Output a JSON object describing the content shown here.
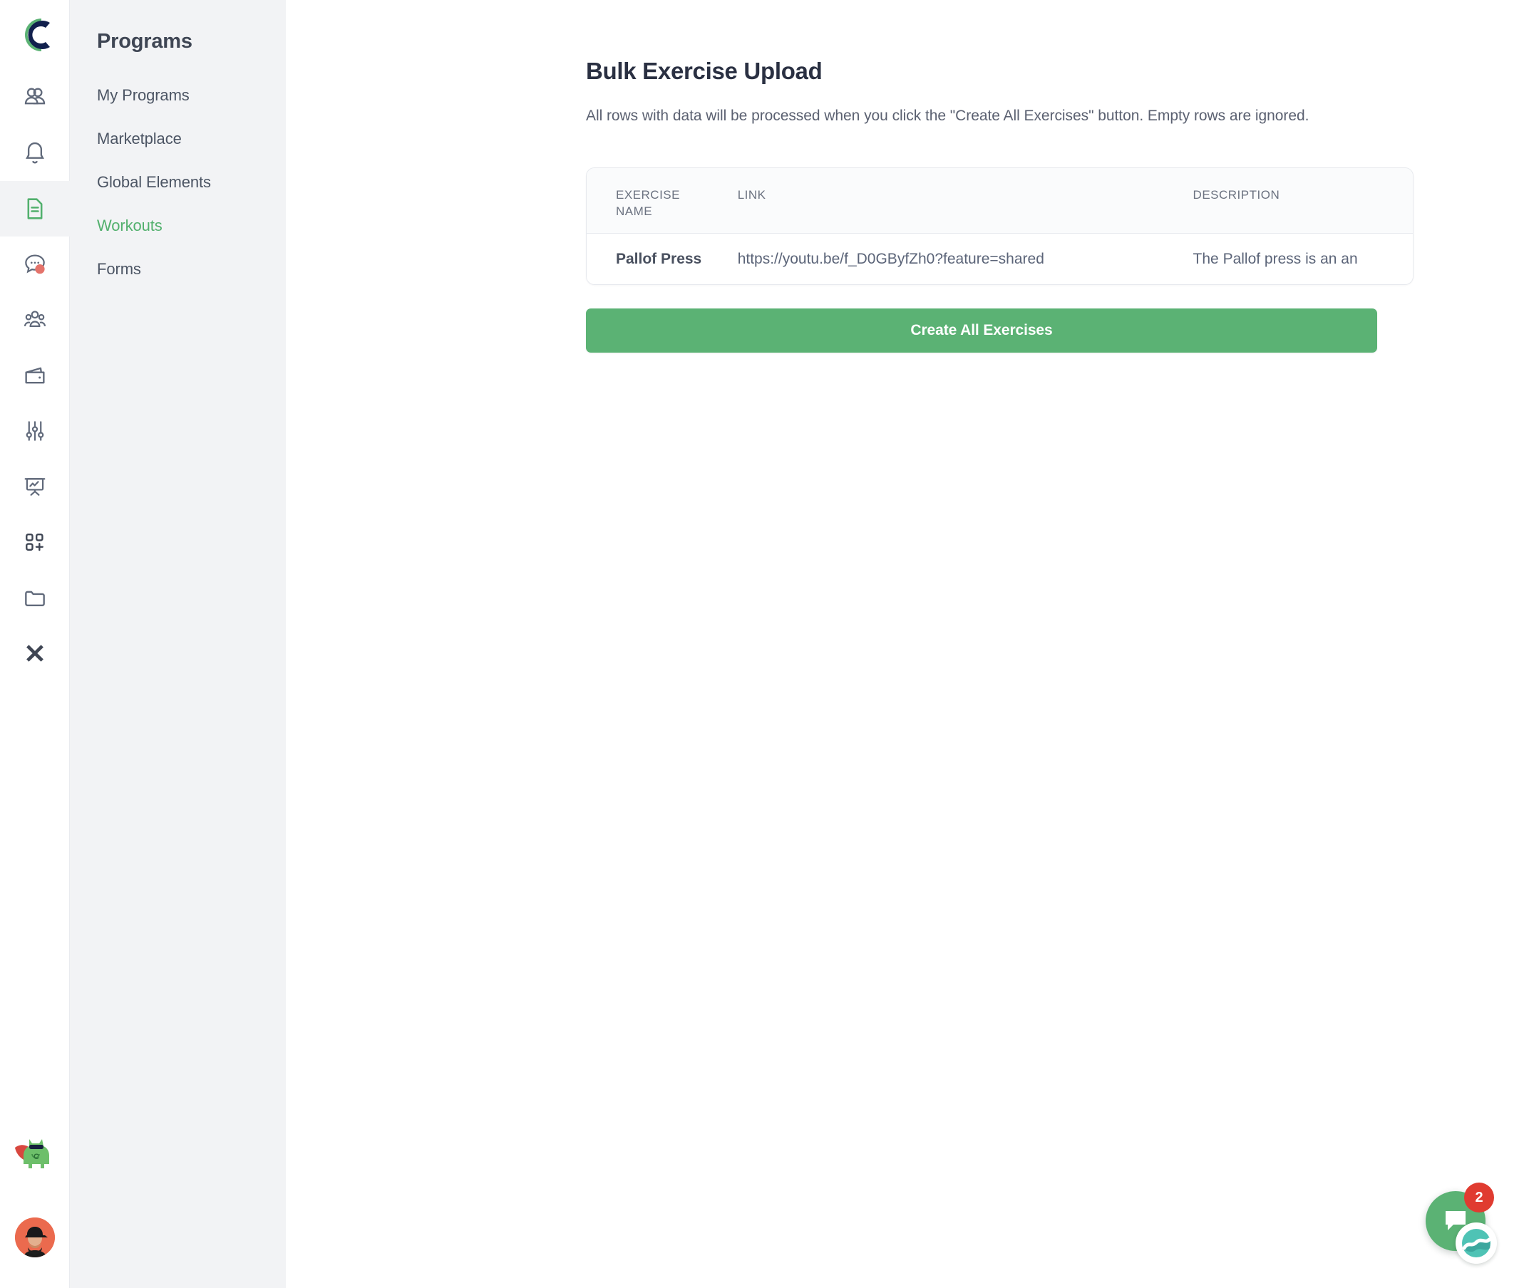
{
  "brand": {
    "logo_letter": "C",
    "logo_green": "#5bb274",
    "logo_navy": "#11204d"
  },
  "colors": {
    "accent_green": "#5bb274",
    "active_nav_green": "#52b06d",
    "sidebar_bg": "#f2f3f5",
    "text_dark": "#3f4654",
    "badge_red": "#e03b30",
    "notification_dot": "#e4736b",
    "avatar_bg": "#eb6a4e"
  },
  "icon_rail": {
    "items": [
      {
        "name": "people-icon",
        "label": "Clients",
        "active": false
      },
      {
        "name": "bell-icon",
        "label": "Notifications",
        "active": false
      },
      {
        "name": "document-icon",
        "label": "Programs",
        "active": true
      },
      {
        "name": "chat-bubble-icon",
        "label": "Messages",
        "active": false,
        "has_dot": true
      },
      {
        "name": "community-group-icon",
        "label": "Community",
        "active": false
      },
      {
        "name": "wallet-icon",
        "label": "Payments",
        "active": false
      },
      {
        "name": "sliders-icon",
        "label": "Settings",
        "active": false
      },
      {
        "name": "presentation-chart-icon",
        "label": "Reports",
        "active": false
      },
      {
        "name": "add-apps-icon",
        "label": "Apps",
        "active": false
      },
      {
        "name": "folder-icon",
        "label": "Files",
        "active": false
      },
      {
        "name": "close-x-icon",
        "label": "Close",
        "active": false
      }
    ],
    "mascot_label": "Mascot",
    "avatar_label": "User avatar"
  },
  "sidebar": {
    "title": "Programs",
    "items": [
      {
        "label": "My Programs",
        "active": false
      },
      {
        "label": "Marketplace",
        "active": false
      },
      {
        "label": "Global Elements",
        "active": false
      },
      {
        "label": "Workouts",
        "active": true
      },
      {
        "label": "Forms",
        "active": false
      }
    ]
  },
  "main": {
    "title": "Bulk Exercise Upload",
    "subtitle": "All rows with data will be processed when you click the \"Create All Exercises\" button. Empty rows are ignored.",
    "table": {
      "columns": [
        "EXERCISE NAME",
        "LINK",
        "DESCRIPTION"
      ],
      "column_name_line1": "EXERCISE",
      "column_name_line2": "NAME",
      "rows": [
        {
          "exercise_name": "Pallof Press",
          "link": "https://youtu.be/f_D0GByfZh0?feature=shared",
          "description": "The Pallof press is an an"
        }
      ]
    },
    "create_button": "Create All Exercises"
  },
  "chat": {
    "badge_count": "2",
    "launcher_label": "Open chat",
    "sub_label": "Intercom"
  }
}
